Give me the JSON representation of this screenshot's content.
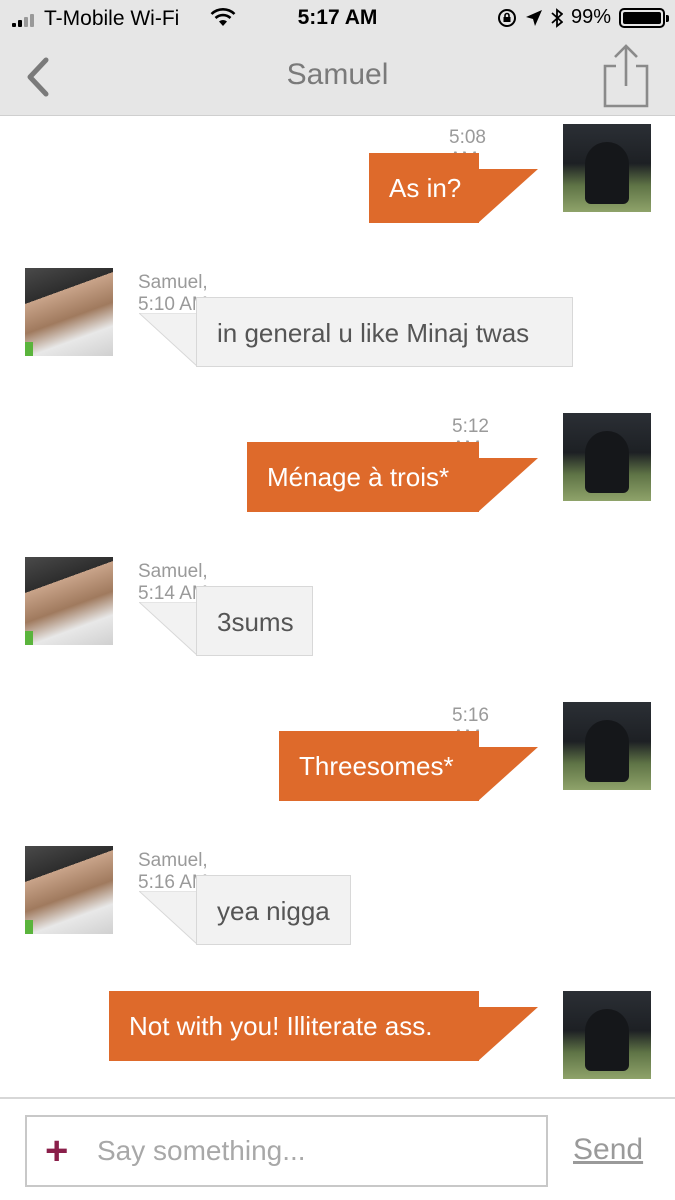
{
  "status_bar": {
    "carrier": "T-Mobile Wi-Fi",
    "time": "5:17 AM",
    "battery": "99%",
    "battery_level": 0.99
  },
  "header": {
    "title": "Samuel"
  },
  "messages": [
    {
      "direction": "outgoing",
      "timestamp": "5:08 AM",
      "text": "As in?"
    },
    {
      "direction": "incoming",
      "timestamp": "Samuel, 5:10 AM",
      "text": "in general u like Minaj twas"
    },
    {
      "direction": "outgoing",
      "timestamp": "5:12 AM",
      "text": "Ménage à trois*"
    },
    {
      "direction": "incoming",
      "timestamp": "Samuel, 5:14 AM",
      "text": "3sums"
    },
    {
      "direction": "outgoing",
      "timestamp": "5:16 AM",
      "text": "Threesomes*"
    },
    {
      "direction": "incoming",
      "timestamp": "Samuel, 5:16 AM",
      "text": "yea nigga"
    },
    {
      "direction": "outgoing",
      "timestamp": "",
      "text": "Not with you! Illiterate ass."
    }
  ],
  "composer": {
    "placeholder": "Say something...",
    "send_label": "Send"
  },
  "colors": {
    "outgoing_bubble": "#de6a2b",
    "incoming_bubble": "#f2f2f2",
    "header_bg": "#e6e6e6",
    "plus_icon": "#8a1f4a"
  },
  "icons": {
    "back": "chevron-left-icon",
    "share": "share-icon",
    "add": "plus-icon"
  }
}
